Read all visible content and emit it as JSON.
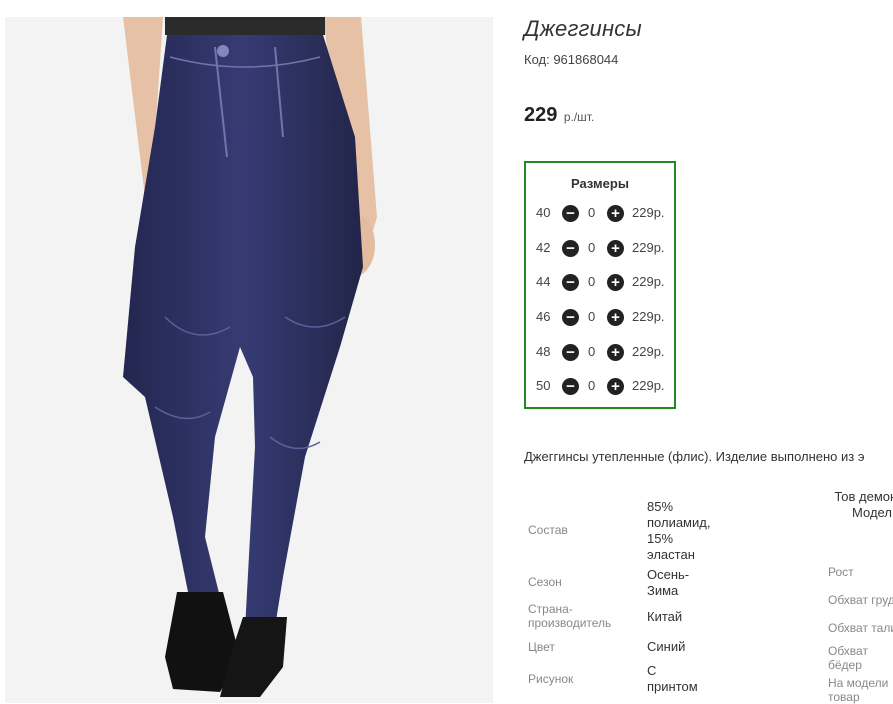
{
  "product": {
    "title": "Джеггинсы",
    "code": "Код: 961868044",
    "price_value": "229",
    "price_unit": "р./шт."
  },
  "sizes": {
    "heading": "Размеры",
    "rows": [
      {
        "size": "40",
        "qty": "0",
        "price": "229р."
      },
      {
        "size": "42",
        "qty": "0",
        "price": "229р."
      },
      {
        "size": "44",
        "qty": "0",
        "price": "229р."
      },
      {
        "size": "46",
        "qty": "0",
        "price": "229р."
      },
      {
        "size": "48",
        "qty": "0",
        "price": "229р."
      },
      {
        "size": "50",
        "qty": "0",
        "price": "229р."
      }
    ]
  },
  "description": "Джеггинсы утепленные (флис). Изделие выполнено из э",
  "attributes": [
    {
      "label": "Состав",
      "value": "85% полиамид, 15% эластан"
    },
    {
      "label": "Сезон",
      "value": "Осень-Зима"
    },
    {
      "label": "Страна-производитель",
      "value": "Китай"
    },
    {
      "label": "Цвет",
      "value": "Синий"
    },
    {
      "label": "Рисунок",
      "value": "С принтом"
    }
  ],
  "model": {
    "heading": "Тов демонст Модел",
    "labels": [
      "Рост",
      "Обхват груд",
      "Обхват тали",
      "Обхват бёдер",
      "На модели товар"
    ]
  },
  "colors": {
    "sizes_border": "#1f8a1f",
    "denim": "#2a2e5e"
  },
  "icons": {
    "minus": "minus-circle-icon",
    "plus": "plus-circle-icon"
  }
}
